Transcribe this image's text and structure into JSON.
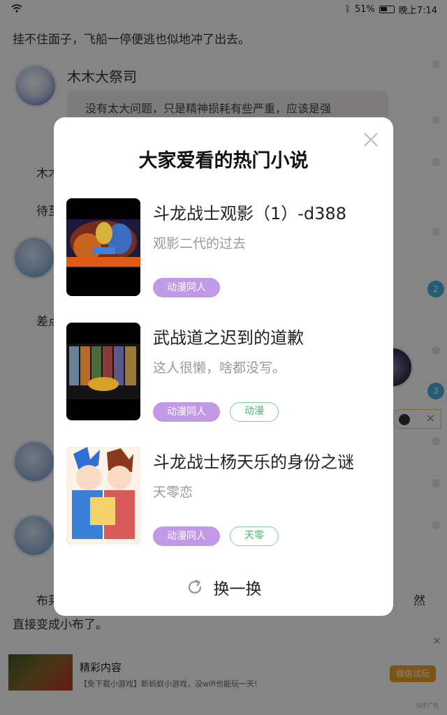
{
  "status_bar": {
    "battery": "51%",
    "time": "晚上7:14"
  },
  "reader": {
    "paragraph_top": "挂不住面子，飞船一停便逃也似地冲了出去。",
    "author_name": "木木大祭司",
    "author_message": "没有太大问题，只是精神损耗有些严重，应该是强",
    "frag_1": "木木",
    "frag_2": "待至",
    "frag_3": "差点",
    "frag_bottom_left": "布莱",
    "frag_bottom_right": "然",
    "paragraph_bottom": "直接变成小布了。",
    "side_badges": [
      "2",
      "3"
    ]
  },
  "ad": {
    "title": "精彩内容",
    "description": "【免下载小游戏】新蚂蚁小游戏，没wifi也能玩一天!",
    "button": "微信试玩",
    "tag": "快手广告"
  },
  "modal": {
    "title": "大家爱看的热门小说",
    "books": [
      {
        "title": "斗龙战士观影（1）-d388",
        "description": "观影二代的过去",
        "tags": [
          {
            "label": "动漫同人",
            "style": "primary"
          }
        ]
      },
      {
        "title": "武战道之迟到的道歉",
        "description": "这人很懒，啥都没写。",
        "tags": [
          {
            "label": "动漫同人",
            "style": "primary"
          },
          {
            "label": "动漫",
            "style": "outline"
          }
        ]
      },
      {
        "title": "斗龙战士杨天乐的身份之谜",
        "description": "天零恋",
        "tags": [
          {
            "label": "动漫同人",
            "style": "primary"
          },
          {
            "label": "天零",
            "style": "outline"
          }
        ]
      }
    ],
    "refresh_label": "换一换"
  },
  "colors": {
    "tag_primary": "#c19ae6",
    "tag_outline": "#49b36c",
    "ad_button": "#f2a22a",
    "badge": "#4ab0d8"
  }
}
